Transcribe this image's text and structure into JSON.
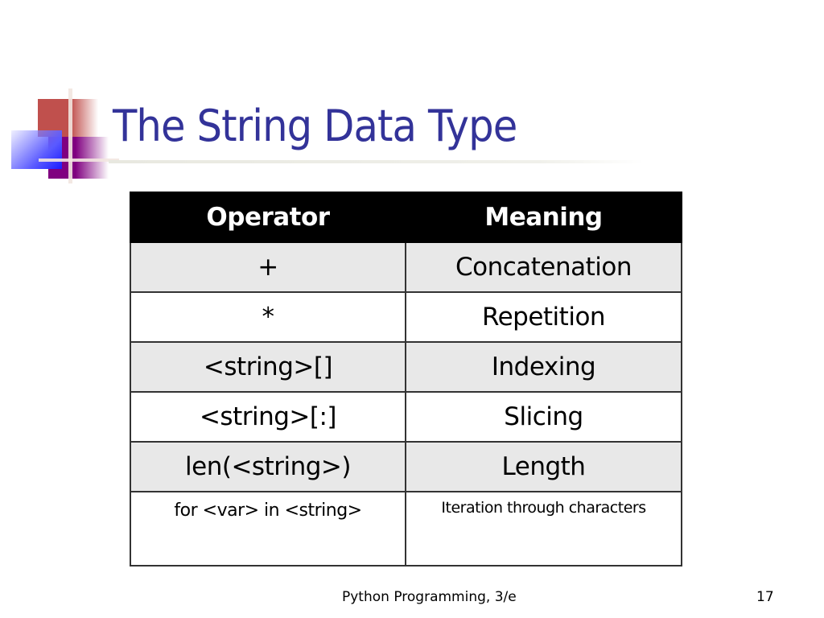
{
  "slide": {
    "title": "The String Data Type",
    "logo_icon": "decorative-squares-logo",
    "colors": {
      "title": "#333399",
      "header_bg": "#000000",
      "header_text": "#ffffff",
      "shaded_row": "#e8e8e8",
      "logo_red": "#c0504d",
      "logo_purple": "#800080",
      "logo_blue": "#1a1aff"
    }
  },
  "table": {
    "headers": [
      "Operator",
      "Meaning"
    ],
    "rows": [
      {
        "operator": "+",
        "meaning": "Concatenation"
      },
      {
        "operator": "*",
        "meaning": "Repetition"
      },
      {
        "operator": "<string>[]",
        "meaning": "Indexing"
      },
      {
        "operator": "<string>[:]",
        "meaning": "Slicing"
      },
      {
        "operator": "len(<string>)",
        "meaning": "Length"
      },
      {
        "operator": "for <var> in <string>",
        "meaning": "Iteration through characters"
      }
    ]
  },
  "footer": {
    "text": "Python Programming, 3/e",
    "page_number": "17"
  }
}
